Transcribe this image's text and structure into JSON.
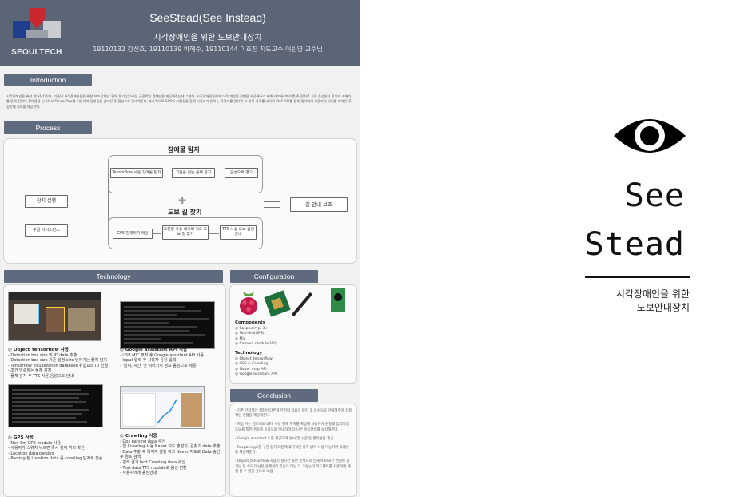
{
  "header": {
    "logo_text": "SEOULTECH",
    "title": "SeeStead(See Instead)",
    "subtitle": "시각장애인을 위한 도보안내장치",
    "authors": "19110132 강신호, 19110139 박혜수, 19110144 이효진   지도교수:이원영 교수님"
  },
  "sections": {
    "introduction": "Introduction",
    "process": "Process",
    "technology": "Technology",
    "configuration": "Configuration",
    "conclusion": "Conclusion"
  },
  "introduction_text": "시각장애인을 위한 안내장치이다. 기존의 시각장애인들을 위한 보조장치는 '길에 동기'있다라는 금전적인 경향만을 제공해주는데 그쳤다. 시각장애인들에게 더욱 개선된 경험을 제공해주기 위해 라즈베리파이를 주 장치로 사용 음성인식 장치와 카메라를 통해 전방의 장애물을 인식하고 Tensorflow를 이용하여 장애물을 감지한 후 음성으로 안내해준다. 추가적으로 GPS와 크롤링을 통해 사용자가 원하는 목적지를 말하면 그 최적 경로를 네이버 MAP API를 통해 찾아내어 사용자의 위치를 파악한 후 길안내 정보를 제공한다.",
  "process": {
    "obstacle_title": "장애물 탐지",
    "walk_title": "도보 길 찾기",
    "device_run": "장치 실행",
    "google_assistant": "구글 어시스턴스",
    "guide": "길 안내 보조",
    "steps_top": [
      "Tensorflow 사용 장애물 탐지",
      "기준을 넘는 물체 감지",
      "음성으로 경고"
    ],
    "steps_bottom": [
      "GPS 현재위치 확인",
      "크롤링 사용 네이버 지도 도보 길 찾기",
      "TTS 사용 도보 음성 안내"
    ]
  },
  "technology": {
    "items": [
      {
        "title": "◎ Object_tensorflow 사용",
        "lines": [
          "- Detection box size 및 ID data 추출",
          "- Detection box size 기준 설정 size 넘어가는 물체 탐지",
          "- Tensorflow visualization database 위험요소 ID 선별",
          "- 조건 만족하는 물체 감지",
          "- 물체 감지 후 TTS 사용 음성으로 안내"
        ]
      },
      {
        "title": "◎ Google assistant API 사용",
        "lines": [
          "- USB MIC 부착 후 Google assistant API 사용",
          "- Input 입력 후 사용자 음성 입력",
          "- '날씨, 시간' 및 여러가지 정보 음성으로 제공"
        ]
      },
      {
        "title": "◎ GPS 사용",
        "lines": [
          "- Neo-6m GPS module 사용",
          "- 사용자가 스위치 누르면 즉시 현재 위치 확인",
          "- Location data parsing",
          "- Parsing 된 Location data 를 crawling 단계로 전송"
        ]
      },
      {
        "title": "◎ Crawling 사용",
        "lines": [
          "- Gps parsing data 수신",
          "- 웹 Crawling 사용 Naver 지도 출발지, 길찾기 data 추출",
          "- Data 추출 후 목적지 설정 하고 Naver 지도로 Data 송신 후 경로 검색",
          "- 검색 결과 text Crawling data 수신",
          "- Text data TTS module로 음성 변환",
          "- 사용자에게 음성안내"
        ]
      }
    ]
  },
  "configuration": {
    "components_title": "Components",
    "components": [
      "◎ Raspberrypi 3+",
      "◎ Neo-6m(GPS)",
      "◎ Mic",
      "◎ Camera module(V2)"
    ],
    "technology_title": "Technology",
    "technology": [
      "◎ Object_tensorflow",
      "◎ GPS & Crawling",
      "◎ Naver map API",
      "◎ Google assistant API"
    ]
  },
  "conclusion": [
    "· 기존 간접적인 경험이 다른게 무언의 장요지 탐지 후 음성으로 안내해주어 직접적인 경험을 제공해준다.",
    "· 처음 가는 경로에도 GPS 사용 현재 위치를 확정해 사용자가 원할때 입력지점 도보를 통한 경로를 음성으로 안내하여 더 나은 이동편의를 보장해준다.",
    "· Google assistant 도한 제공하여 날씨 및 시간 등 편의성을 제공",
    "· Raspberrypi를 구현 장치 때문에 휴기적인 장치 없이 사용 가능하여 휴대성을 제공해준다.",
    "· Object_tensorflow 사용시 실시간 화면 분석으로 인해 frame간 연결이 끊기는 등 속도가 낮은 문제점이 있는데 이는 더 고성능의 하드웨어를 사용하면 해결 될 수 있을 것으로 보임"
  ],
  "brand": {
    "icon": "eye-icon",
    "line1": "See",
    "line2": "Stead",
    "kr1": "시각장애인을 위한",
    "kr2": "도보안내장치"
  }
}
